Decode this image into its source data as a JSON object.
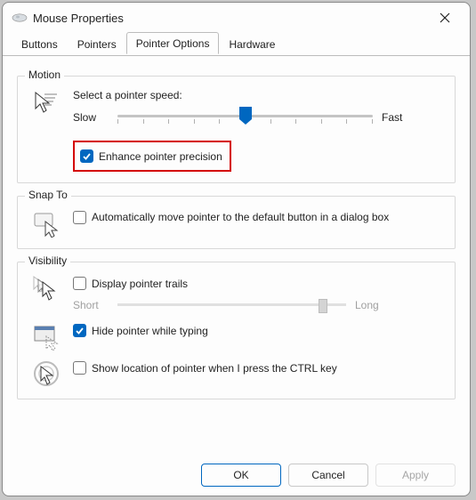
{
  "window": {
    "title": "Mouse Properties"
  },
  "tabs": [
    "Buttons",
    "Pointers",
    "Pointer Options",
    "Hardware"
  ],
  "active_tab_index": 2,
  "motion": {
    "group_label": "Motion",
    "speed_label": "Select a pointer speed:",
    "slow": "Slow",
    "fast": "Fast",
    "slider_value": 5,
    "slider_min": 0,
    "slider_max": 10,
    "enhance_label": "Enhance pointer precision",
    "enhance_checked": true
  },
  "snap": {
    "group_label": "Snap To",
    "auto_label": "Automatically move pointer to the default button in a dialog box",
    "auto_checked": false
  },
  "visibility": {
    "group_label": "Visibility",
    "trails_label": "Display pointer trails",
    "trails_checked": false,
    "trails_short": "Short",
    "trails_long": "Long",
    "trails_value": 9,
    "hide_label": "Hide pointer while typing",
    "hide_checked": true,
    "ctrl_label": "Show location of pointer when I press the CTRL key",
    "ctrl_checked": false
  },
  "buttons": {
    "ok": "OK",
    "cancel": "Cancel",
    "apply": "Apply"
  }
}
